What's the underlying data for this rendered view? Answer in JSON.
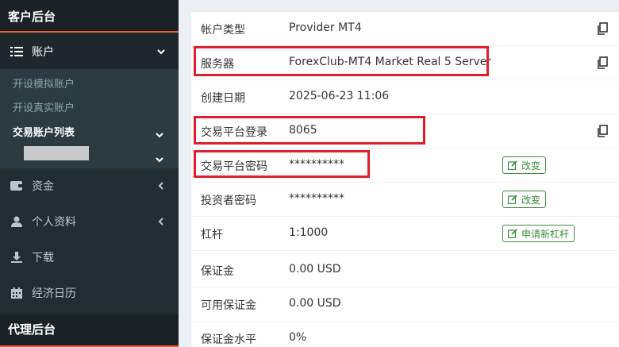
{
  "sidebar": {
    "brand": "客户后台",
    "accounts_label": "账户",
    "submenu": {
      "open_demo": "开设模拟账户",
      "open_real": "开设真实账户",
      "account_list": "交易账户列表"
    },
    "items": [
      {
        "label": "资金",
        "icon": "wallet-icon"
      },
      {
        "label": "个人资料",
        "icon": "user-icon"
      },
      {
        "label": "下载",
        "icon": "download-icon"
      },
      {
        "label": "经济日历",
        "icon": "calendar-icon"
      }
    ],
    "agent_title": "代理后台"
  },
  "details": {
    "account_type": {
      "label": "帐户类型",
      "value": "Provider MT4"
    },
    "server": {
      "label": "服务器",
      "value": "ForexClub-MT4 Market Real 5 Server"
    },
    "created": {
      "label": "创建日期",
      "value": "2025-06-23 11:06"
    },
    "login": {
      "label": "交易平台登录",
      "value": "8065"
    },
    "password": {
      "label": "交易平台密码",
      "value": "**********",
      "button": "改变"
    },
    "investor_password": {
      "label": "投资者密码",
      "value": "**********",
      "button": "改变"
    },
    "leverage": {
      "label": "杠杆",
      "value": "1:1000",
      "button": "申请新杠杆"
    },
    "margin": {
      "label": "保证金",
      "value": "0.00 USD"
    },
    "free_margin": {
      "label": "可用保证金",
      "value": "0.00 USD"
    },
    "margin_level": {
      "label": "保证金水平",
      "value": "0%"
    }
  },
  "colors": {
    "highlight": "#e11d2b",
    "accent": "#3c8d3c",
    "sidebar": "#222d32"
  }
}
